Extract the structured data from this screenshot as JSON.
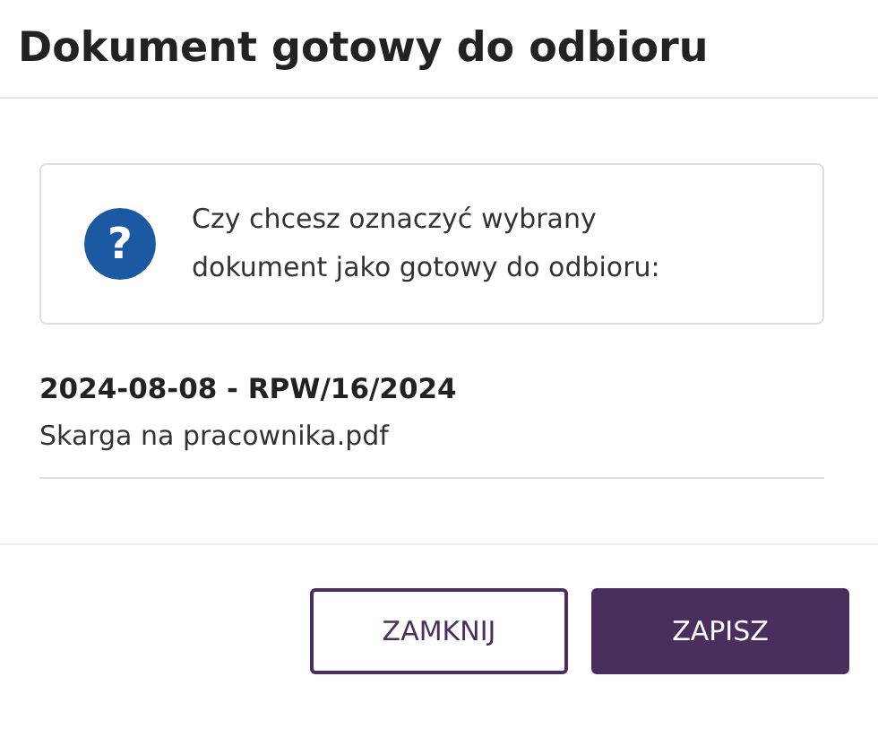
{
  "dialog": {
    "title": "Dokument gotowy do odbioru",
    "message": {
      "icon": "?",
      "text": "Czy chcesz oznaczyć wybrany dokument jako gotowy do odbioru:"
    },
    "document": {
      "reference": "2024-08-08 - RPW/16/2024",
      "file": "Skarga na pracownika.pdf"
    },
    "buttons": [
      {
        "label": "ZAMKNIJ",
        "kind": "secondary"
      },
      {
        "label": "ZAPISZ",
        "kind": "primary"
      }
    ]
  }
}
